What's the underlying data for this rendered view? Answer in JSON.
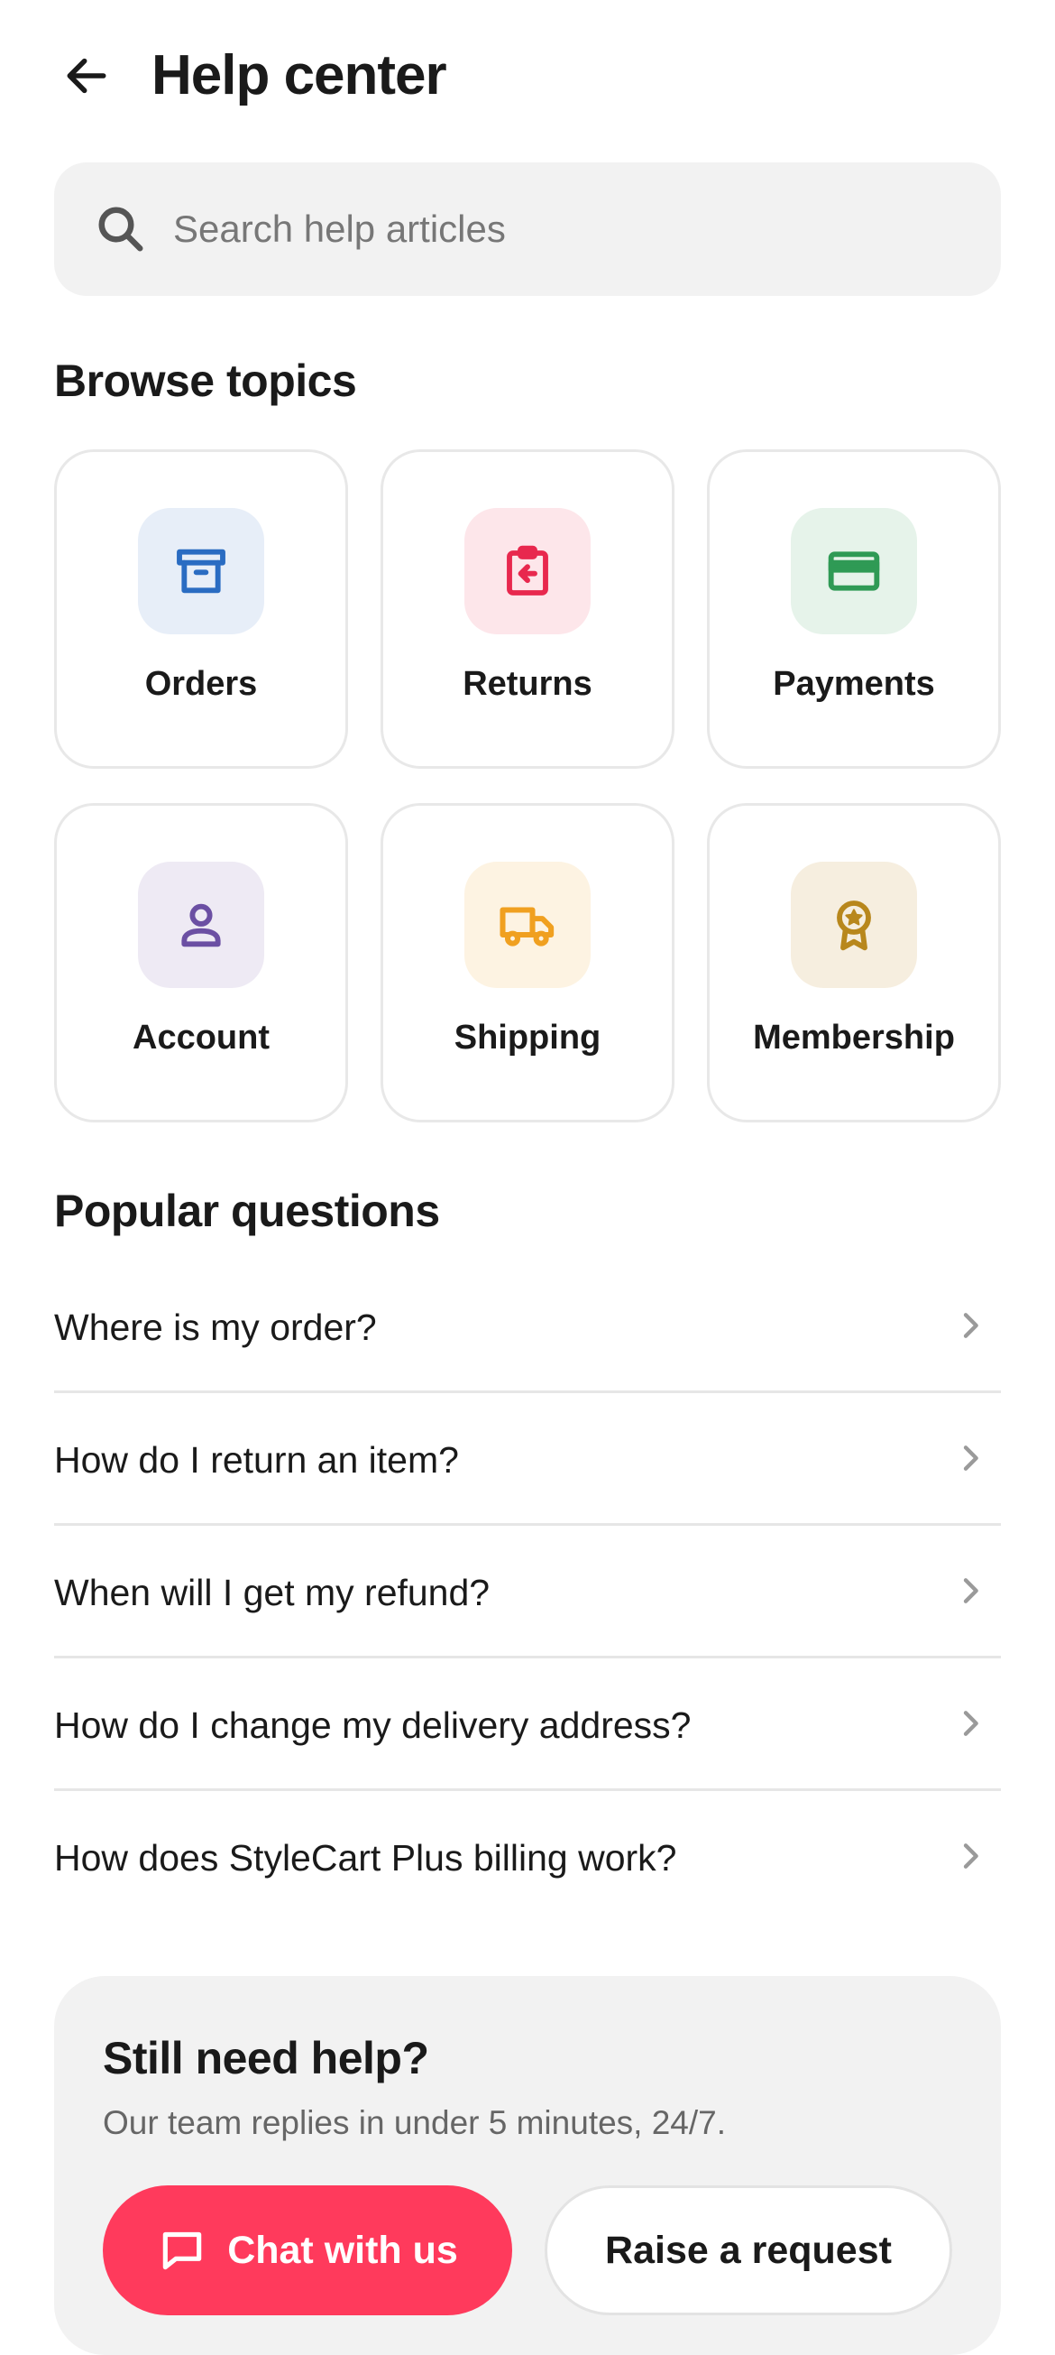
{
  "header": {
    "title": "Help center",
    "back_icon": "arrow-left-icon"
  },
  "search": {
    "placeholder": "Search help articles",
    "value": "",
    "icon": "search-icon"
  },
  "topics": {
    "title": "Browse topics",
    "items": [
      {
        "label": "Orders",
        "icon": "archive-box-icon",
        "color": "#2a6cc2",
        "bg": "#e7eef8"
      },
      {
        "label": "Returns",
        "icon": "clipboard-return-icon",
        "color": "#e8284e",
        "bg": "#fde6ea"
      },
      {
        "label": "Payments",
        "icon": "credit-card-icon",
        "color": "#2f9a55",
        "bg": "#e6f3ea"
      },
      {
        "label": "Account",
        "icon": "user-icon",
        "color": "#6b4fa3",
        "bg": "#eeeaf4"
      },
      {
        "label": "Shipping",
        "icon": "truck-icon",
        "color": "#f0a020",
        "bg": "#fdf3e2"
      },
      {
        "label": "Membership",
        "icon": "award-badge-icon",
        "color": "#b8871c",
        "bg": "#f6eedf"
      }
    ]
  },
  "faq": {
    "title": "Popular questions",
    "items": [
      {
        "question": "Where is my order?"
      },
      {
        "question": "How do I return an item?"
      },
      {
        "question": "When will I get my refund?"
      },
      {
        "question": "How do I change my delivery address?"
      },
      {
        "question": "How does StyleCart Plus billing work?"
      }
    ]
  },
  "help": {
    "title": "Still need help?",
    "subtitle": "Our team replies in under 5 minutes, 24/7.",
    "chat_label": "Chat with us",
    "request_label": "Raise a request",
    "accent": "#ff3a5c"
  }
}
